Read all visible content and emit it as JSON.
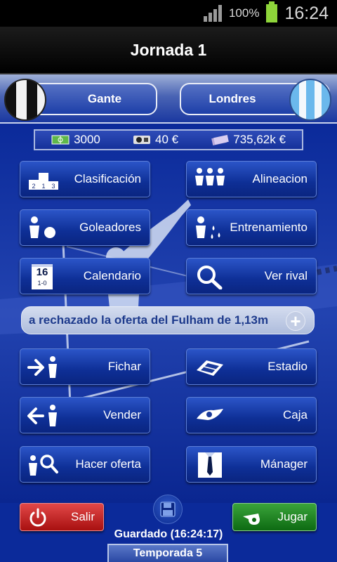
{
  "status_bar": {
    "battery": "100%",
    "time": "16:24"
  },
  "header": {
    "title": "Jornada 1"
  },
  "match": {
    "home_team": "Gante",
    "away_team": "Londres"
  },
  "resources": {
    "capacity": "3000",
    "ticket_price": "40 €",
    "cash": "735,62k €"
  },
  "menu": {
    "clasificacion": "Clasificación",
    "alineacion": "Alineacion",
    "goleadores": "Goleadores",
    "entrenamiento": "Entrenamiento",
    "calendario": "Calendario",
    "calendar_day": "16",
    "calendar_score": "1-0",
    "ver_rival": "Ver rival",
    "fichar": "Fichar",
    "estadio": "Estadio",
    "vender": "Vender",
    "caja": "Caja",
    "hacer_oferta": "Hacer oferta",
    "manager": "Mánager"
  },
  "ticker": {
    "text": "a rechazado la oferta del Fulham de 1,13m"
  },
  "footer": {
    "exit": "Salir",
    "play": "Jugar",
    "saved": "Guardado (16:24:17)",
    "season": "Temporada 5"
  },
  "colors": {
    "background": "#0b2a9a",
    "button": "#0e2f96",
    "exit": "#a81010",
    "play": "#0d6a12"
  }
}
